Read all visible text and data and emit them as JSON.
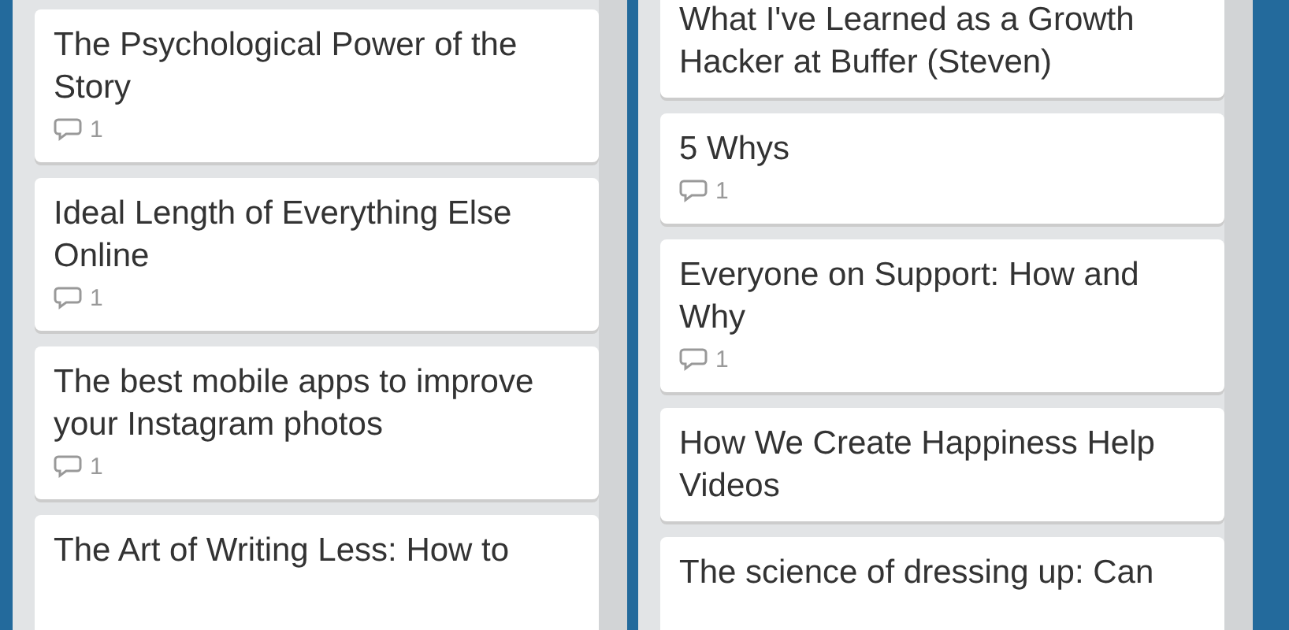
{
  "lists": [
    {
      "cards": [
        {
          "title": "The Psychological Power of the Story",
          "comments": "1"
        },
        {
          "title": "Ideal Length of Everything Else Online",
          "comments": "1"
        },
        {
          "title": "The best mobile apps to improve your Instagram photos",
          "comments": "1"
        },
        {
          "title": "The Art of Writing Less: How to"
        }
      ]
    },
    {
      "cards": [
        {
          "title": "What I've Learned as a Growth Hacker at Buffer (Steven)"
        },
        {
          "title": "5 Whys",
          "comments": "1"
        },
        {
          "title": "Everyone on Support: How and Why",
          "comments": "1"
        },
        {
          "title": "How We Create Happiness Help Videos"
        },
        {
          "title": "The science of dressing up: Can"
        }
      ]
    }
  ]
}
